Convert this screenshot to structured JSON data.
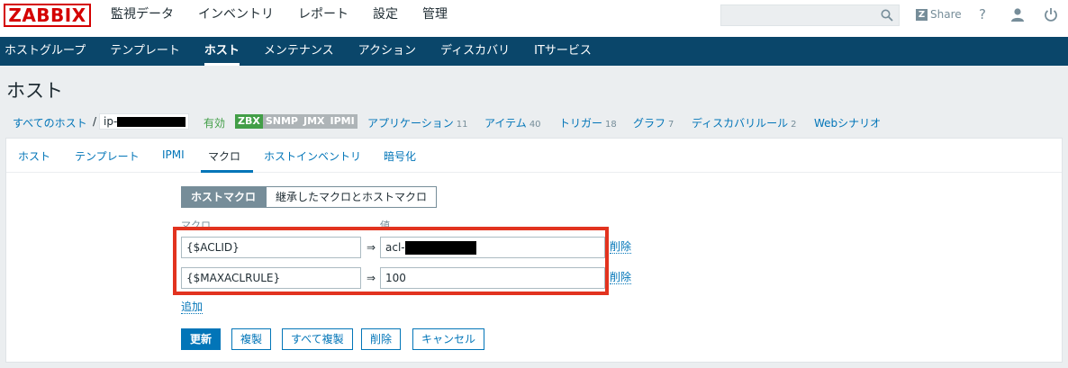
{
  "brand": "ZABBIX",
  "top_nav": [
    "監視データ",
    "インベントリ",
    "レポート",
    "設定",
    "管理"
  ],
  "share_label": "Share",
  "help_label": "?",
  "sub_nav": [
    "ホストグループ",
    "テンプレート",
    "ホスト",
    "メンテナンス",
    "アクション",
    "ディスカバリ",
    "ITサービス"
  ],
  "sub_nav_active": "ホスト",
  "page_title": "ホスト",
  "breadcrumb": {
    "all_hosts": "すべてのホスト",
    "separator": "/",
    "host_prefix": "ip-",
    "status": "有効",
    "availability": [
      "ZBX",
      "SNMP",
      "JMX",
      "IPMI"
    ],
    "links": [
      {
        "label": "アプリケーション",
        "count": "11"
      },
      {
        "label": "アイテム",
        "count": "40"
      },
      {
        "label": "トリガー",
        "count": "18"
      },
      {
        "label": "グラフ",
        "count": "7"
      },
      {
        "label": "ディスカバリルール",
        "count": "2"
      },
      {
        "label": "Webシナリオ",
        "count": ""
      }
    ]
  },
  "tabs": [
    "ホスト",
    "テンプレート",
    "IPMI",
    "マクロ",
    "ホストインベントリ",
    "暗号化"
  ],
  "active_tab": "マクロ",
  "macro_toggle": {
    "host": "ホストマクロ",
    "inherited": "継承したマクロとホストマクロ"
  },
  "columns": {
    "macro": "マクロ",
    "value": "値"
  },
  "macros": [
    {
      "name": "{$ACLID}",
      "arrow": "⇒",
      "value": "acl-",
      "remove": "削除"
    },
    {
      "name": "{$MAXACLRULE}",
      "arrow": "⇒",
      "value": "100",
      "remove": "削除"
    }
  ],
  "add_label": "追加",
  "buttons": {
    "update": "更新",
    "clone": "複製",
    "full_clone": "すべて複製",
    "delete": "削除",
    "cancel": "キャンセル"
  },
  "colors": {
    "brand_red": "#d40000",
    "nav_dark": "#0a466a",
    "link_blue": "#0275b8",
    "enabled_green": "#429e47",
    "highlight_red": "#e2331f"
  }
}
